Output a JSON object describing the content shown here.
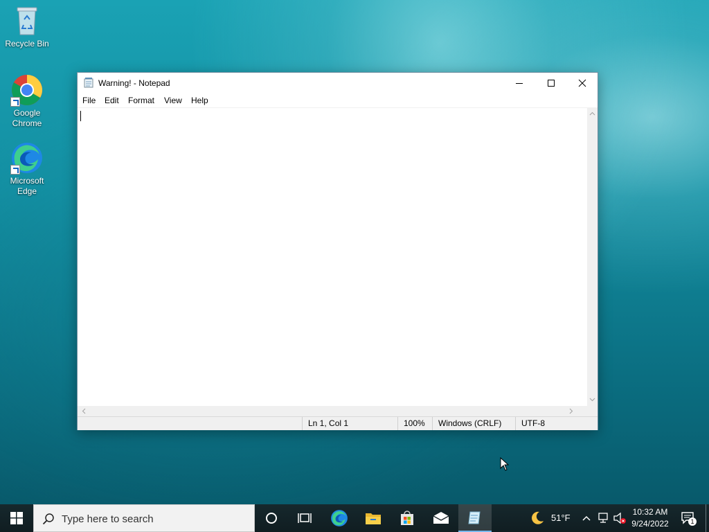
{
  "desktop": {
    "icons": [
      {
        "label": "Recycle Bin"
      },
      {
        "label": "Google\nChrome",
        "line1": "Google",
        "line2": "Chrome"
      },
      {
        "label": "Microsoft\nEdge",
        "line1": "Microsoft",
        "line2": "Edge"
      }
    ]
  },
  "window": {
    "title": "Warning! - Notepad",
    "menu": [
      "File",
      "Edit",
      "Format",
      "View",
      "Help"
    ],
    "content": "",
    "status": {
      "position": "Ln 1, Col 1",
      "zoom": "100%",
      "line_ending": "Windows (CRLF)",
      "encoding": "UTF-8"
    }
  },
  "taskbar": {
    "search_placeholder": "Type here to search",
    "weather": "51°F",
    "time": "10:32 AM",
    "date": "9/24/2022",
    "notification_count": "1"
  },
  "colors": {
    "taskbar_bg": "#101d21",
    "window_border": "#6f8ea0",
    "accent": "#0078d4"
  }
}
